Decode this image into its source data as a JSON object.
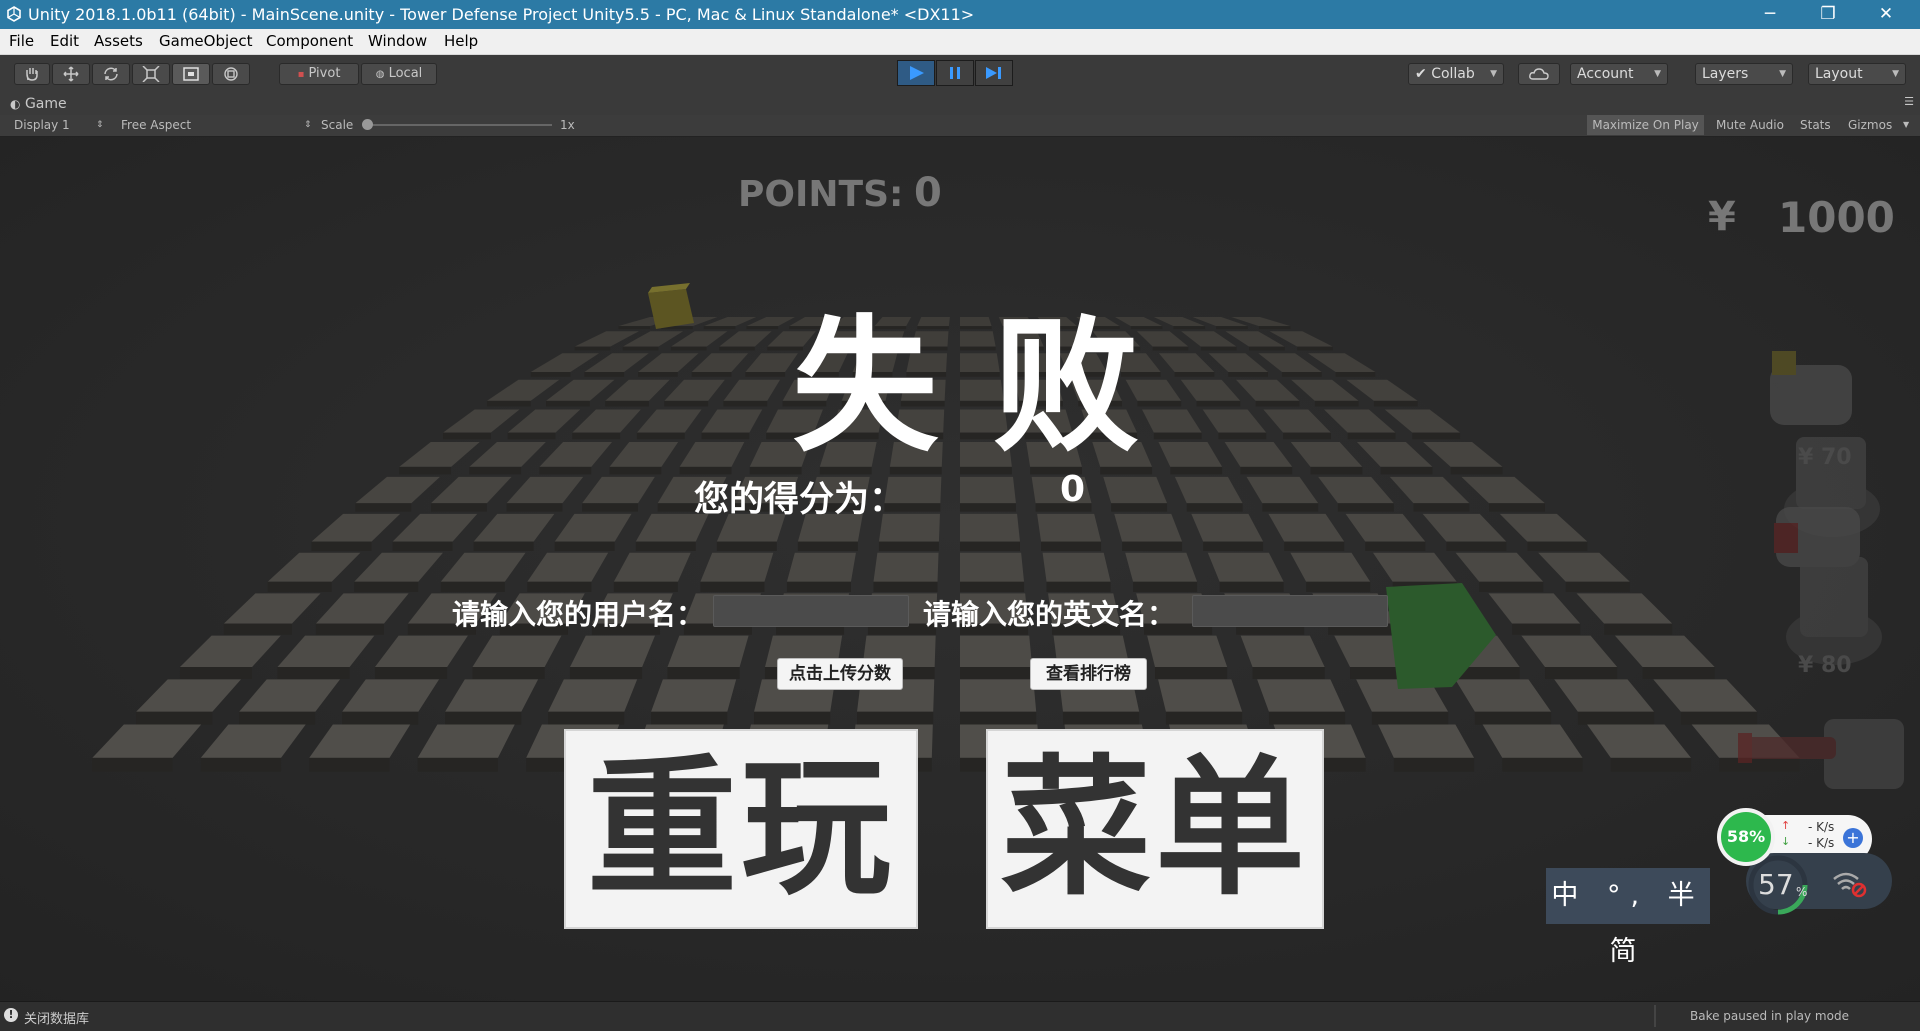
{
  "window": {
    "title": "Unity 2018.1.0b11 (64bit) - MainScene.unity - Tower Defense Project Unity5.5 - PC, Mac & Linux Standalone* <DX11>",
    "minimize_glyph": "─",
    "restore_glyph": "❐",
    "close_glyph": "✕"
  },
  "menu": [
    "File",
    "Edit",
    "Assets",
    "GameObject",
    "Component",
    "Window",
    "Help"
  ],
  "toolbar": {
    "pivot_label": "Pivot",
    "local_label": "Local",
    "collab_label": "Collab",
    "account_label": "Account",
    "layers_label": "Layers",
    "layout_label": "Layout"
  },
  "game_view": {
    "tab_label": "Game",
    "display_label": "Display 1",
    "aspect_label": "Free Aspect",
    "scale_label": "Scale",
    "scale_value": "1x",
    "maximize_label": "Maximize On Play",
    "mute_label": "Mute Audio",
    "stats_label": "Stats",
    "gizmos_label": "Gizmos"
  },
  "hud": {
    "points_label": "POINTS:",
    "points_value": "0",
    "currency_symbol": "¥",
    "money_value": "1000",
    "turret_cost_1": "¥ 70",
    "turret_cost_2": "¥ 80"
  },
  "game_over": {
    "title": "失 败",
    "score_label": "您的得分为：",
    "score_value": "0",
    "username_label": "请输入您的用户名：",
    "username_value": "",
    "english_name_label": "请输入您的英文名：",
    "english_name_value": "",
    "upload_button": "点击上传分数",
    "leaderboard_button": "查看排行榜",
    "replay_button": "重玩",
    "menu_button": "菜单"
  },
  "overlay": {
    "memory_percent": "58%",
    "upload_speed": "- K/s",
    "download_speed": "- K/s",
    "cpu_percent": "57",
    "cpu_unit": "%",
    "ime_text": "中 °, 半 简"
  },
  "status": {
    "left_text": "关闭数据库",
    "right_text": "Bake paused in play mode"
  },
  "colors": {
    "titlebar": "#2c7aa5",
    "play_active": "#2f5b85",
    "memory_ring": "#2db84d"
  }
}
